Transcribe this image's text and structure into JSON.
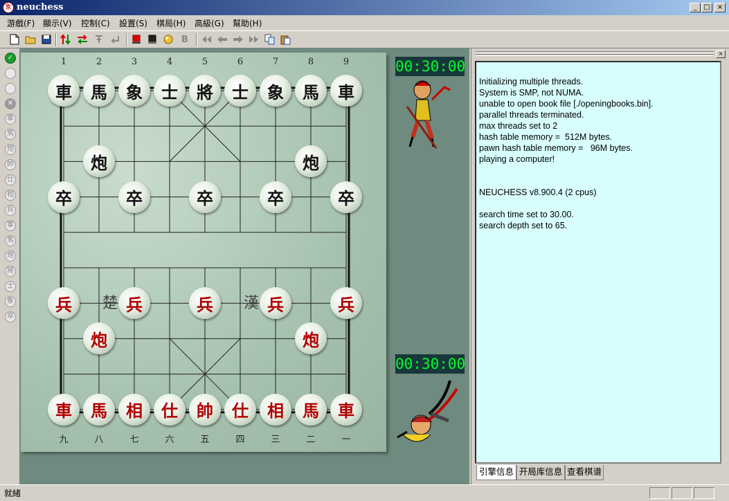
{
  "window": {
    "title": "neuchess",
    "app_icon": "象",
    "minimize_glyph": "_",
    "maximize_glyph": "□",
    "close_glyph": "×"
  },
  "menu": [
    "游戲(F)",
    "顯示(V)",
    "控制(C)",
    "設置(S)",
    "棋局(H)",
    "高級(G)",
    "幫助(H)"
  ],
  "toolbar": {
    "icons": [
      "new-file-icon",
      "open-folder-icon",
      "save-icon",
      "flip-vertical-icon",
      "swap-sides-icon",
      "hint-icon",
      "undo-enter-icon",
      "red-side-icon",
      "black-side-icon",
      "engine-ball-icon",
      "bold-b-icon",
      "first-move-icon",
      "prev-move-icon",
      "next-move-icon",
      "last-move-icon",
      "copy-icon",
      "paste-icon"
    ],
    "bold_label": "B"
  },
  "sidebar_icons": [
    "✓",
    "",
    "",
    "✕",
    "車",
    "馬",
    "炮",
    "帥",
    "仕",
    "相",
    "兵",
    "車",
    "馬",
    "炮",
    "將",
    "士",
    "象",
    "卒"
  ],
  "board": {
    "column_numbers_top": [
      "1",
      "2",
      "3",
      "4",
      "5",
      "6",
      "7",
      "8",
      "9"
    ],
    "column_numbers_bottom": [
      "九",
      "八",
      "七",
      "六",
      "五",
      "四",
      "三",
      "二",
      "一"
    ],
    "river_left": "楚　河",
    "river_right": "漢　界",
    "pieces": [
      {
        "text": "車",
        "side": "black",
        "file": 0,
        "rank": 0
      },
      {
        "text": "馬",
        "side": "black",
        "file": 1,
        "rank": 0
      },
      {
        "text": "象",
        "side": "black",
        "file": 2,
        "rank": 0
      },
      {
        "text": "士",
        "side": "black",
        "file": 3,
        "rank": 0
      },
      {
        "text": "將",
        "side": "black",
        "file": 4,
        "rank": 0
      },
      {
        "text": "士",
        "side": "black",
        "file": 5,
        "rank": 0
      },
      {
        "text": "象",
        "side": "black",
        "file": 6,
        "rank": 0
      },
      {
        "text": "馬",
        "side": "black",
        "file": 7,
        "rank": 0
      },
      {
        "text": "車",
        "side": "black",
        "file": 8,
        "rank": 0
      },
      {
        "text": "炮",
        "side": "black",
        "file": 1,
        "rank": 2
      },
      {
        "text": "炮",
        "side": "black",
        "file": 7,
        "rank": 2
      },
      {
        "text": "卒",
        "side": "black",
        "file": 0,
        "rank": 3
      },
      {
        "text": "卒",
        "side": "black",
        "file": 2,
        "rank": 3
      },
      {
        "text": "卒",
        "side": "black",
        "file": 4,
        "rank": 3
      },
      {
        "text": "卒",
        "side": "black",
        "file": 6,
        "rank": 3
      },
      {
        "text": "卒",
        "side": "black",
        "file": 8,
        "rank": 3
      },
      {
        "text": "兵",
        "side": "red",
        "file": 0,
        "rank": 6
      },
      {
        "text": "兵",
        "side": "red",
        "file": 2,
        "rank": 6
      },
      {
        "text": "兵",
        "side": "red",
        "file": 4,
        "rank": 6
      },
      {
        "text": "兵",
        "side": "red",
        "file": 6,
        "rank": 6
      },
      {
        "text": "兵",
        "side": "red",
        "file": 8,
        "rank": 6
      },
      {
        "text": "炮",
        "side": "red",
        "file": 1,
        "rank": 7
      },
      {
        "text": "炮",
        "side": "red",
        "file": 7,
        "rank": 7
      },
      {
        "text": "車",
        "side": "red",
        "file": 0,
        "rank": 9
      },
      {
        "text": "馬",
        "side": "red",
        "file": 1,
        "rank": 9
      },
      {
        "text": "相",
        "side": "red",
        "file": 2,
        "rank": 9
      },
      {
        "text": "仕",
        "side": "red",
        "file": 3,
        "rank": 9
      },
      {
        "text": "帥",
        "side": "red",
        "file": 4,
        "rank": 9
      },
      {
        "text": "仕",
        "side": "red",
        "file": 5,
        "rank": 9
      },
      {
        "text": "相",
        "side": "red",
        "file": 6,
        "rank": 9
      },
      {
        "text": "馬",
        "side": "red",
        "file": 7,
        "rank": 9
      },
      {
        "text": "車",
        "side": "red",
        "file": 8,
        "rank": 9
      }
    ]
  },
  "clocks": {
    "top": "00:30:00",
    "bottom": "00:30:00"
  },
  "console": {
    "lines": [
      "Initializing multiple threads.",
      "System is SMP, not NUMA.",
      "unable to open book file [./openingbooks.bin].",
      "parallel threads terminated.",
      "max threads set to 2",
      "hash table memory =  512M bytes.",
      "pawn hash table memory =   96M bytes.",
      "playing a computer!",
      "",
      "",
      "NEUCHESS v8.900.4 (2 cpus)",
      "",
      "search time set to 30.00.",
      "search depth set to 65."
    ]
  },
  "tabs": [
    "引擎信息",
    "开局库信息",
    "查看棋谱"
  ],
  "status": {
    "text": "就緒"
  },
  "colors": {
    "clock_text": "#00ff2a",
    "clock_bg": "#17373a",
    "red_piece": "#b00000",
    "console_bg": "#d8fdfd"
  }
}
